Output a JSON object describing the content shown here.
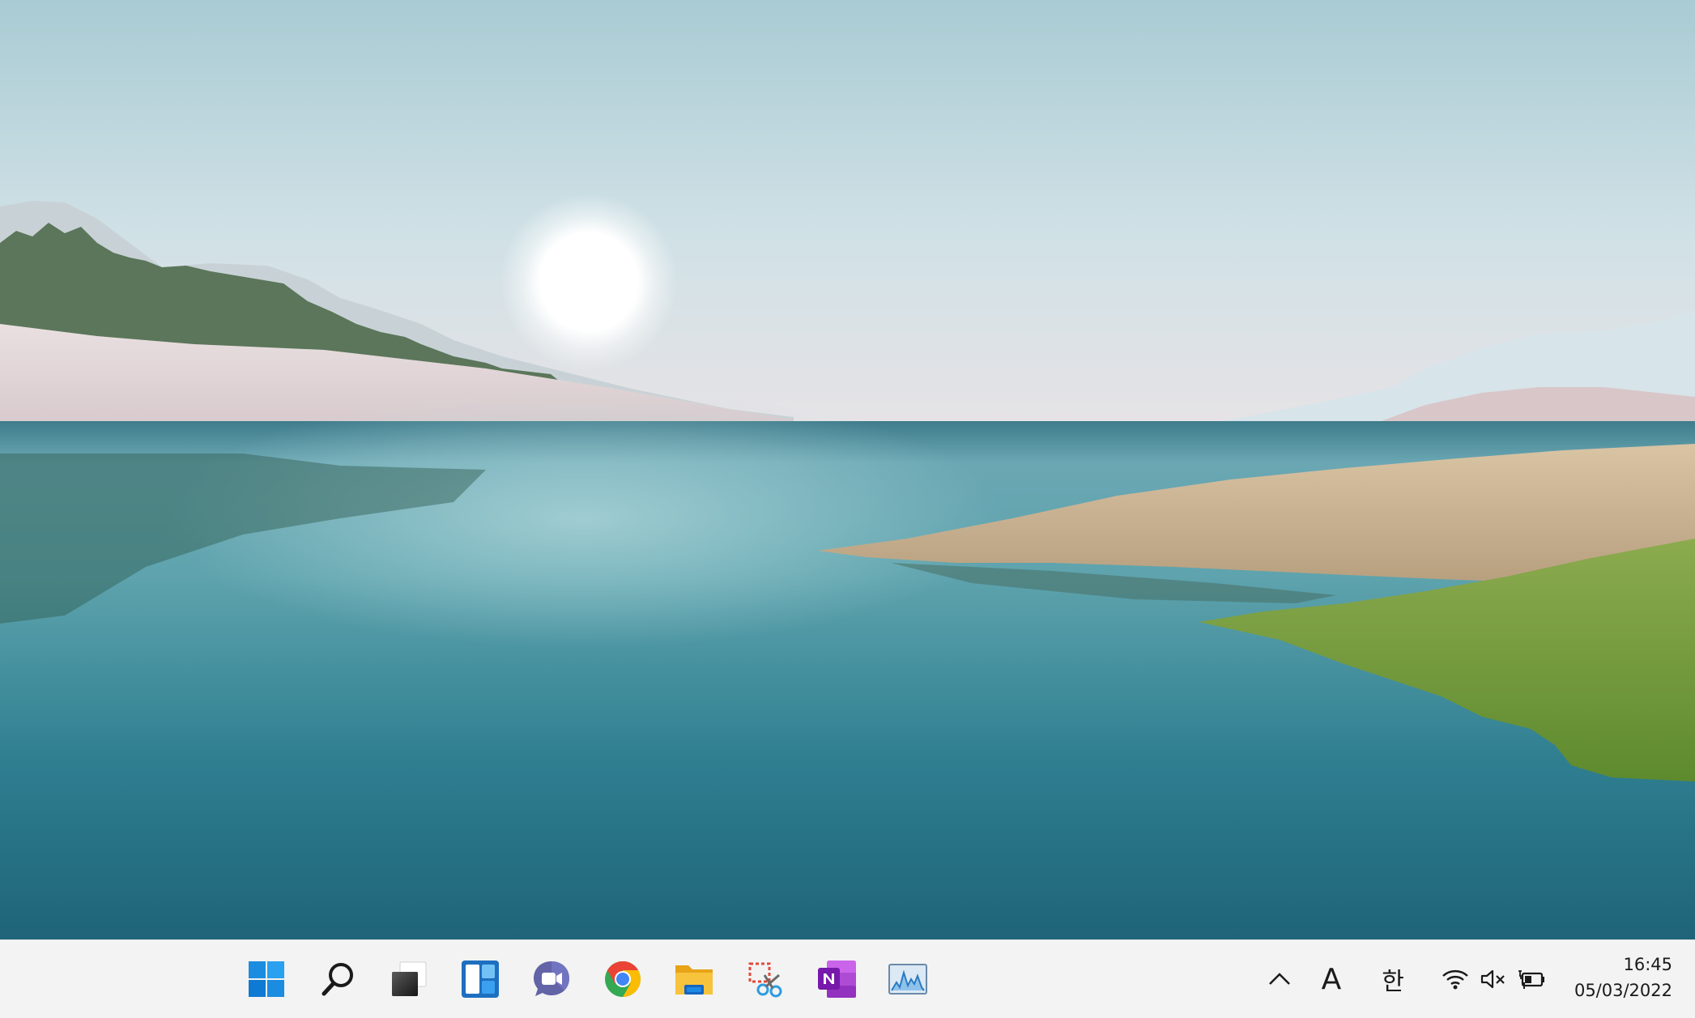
{
  "desktop": {
    "wallpaper": "windows-11-bloom-lake-landscape"
  },
  "taskbar": {
    "pinned": [
      {
        "name": "start",
        "icon": "windows-start-icon"
      },
      {
        "name": "search",
        "icon": "search-icon"
      },
      {
        "name": "task-view",
        "icon": "task-view-icon"
      },
      {
        "name": "widgets",
        "icon": "widgets-icon"
      },
      {
        "name": "teams-chat",
        "icon": "teams-chat-icon"
      },
      {
        "name": "chrome",
        "icon": "chrome-icon"
      },
      {
        "name": "file-explorer",
        "icon": "file-explorer-icon"
      },
      {
        "name": "snipping-tool",
        "icon": "snipping-tool-icon"
      },
      {
        "name": "onenote",
        "icon": "onenote-icon"
      },
      {
        "name": "resource-monitor",
        "icon": "performance-monitor-icon"
      }
    ],
    "tray": {
      "overflow_icon": "chevron-up-icon",
      "input_mode": "A",
      "ime_language": "한",
      "wifi_icon": "wifi-icon",
      "volume_icon": "volume-muted-icon",
      "battery_icon": "battery-charging-icon"
    },
    "clock": {
      "time": "16:45",
      "date": "05/03/2022"
    }
  },
  "colors": {
    "taskbar_bg": "#f3f3f3",
    "windows_blue": "#0078d4",
    "chrome_red": "#ea4335",
    "chrome_yellow": "#fbbc05",
    "chrome_green": "#34a853",
    "chrome_blue": "#4285f4",
    "onenote_purple": "#7719aa",
    "teams_purple": "#5b5fc7",
    "explorer_yellow": "#f8c33c"
  }
}
